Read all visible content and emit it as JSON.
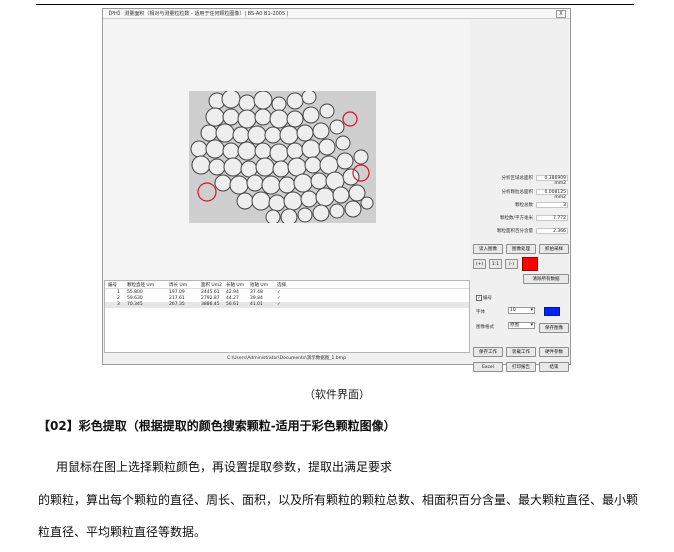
{
  "window": {
    "title": "【PH】 测量面积（相对与测量粒粒数 - 适用于任何颗粒图像）| BS-A0 B1-2005 |",
    "close": "X"
  },
  "results": [
    {
      "label": "分析区域总面积",
      "value": "0.386909 mm2"
    },
    {
      "label": "分析颗粒总面积",
      "value": "0.008125 mm2"
    },
    {
      "label": "颗粒总数",
      "value": "3"
    },
    {
      "label": "颗粒数/平方毫米",
      "value": "7.772"
    },
    {
      "label": "颗粒面积百分含量",
      "value": "2.366"
    }
  ],
  "buttons": {
    "open_image": "读入图像",
    "image_process": "图像处理",
    "pick_color": "抓拍采样",
    "zoom_in": "(+)",
    "zoom_fit": "1:1",
    "zoom_out": "(-)",
    "clear_all": "清除所有数据",
    "save_image": "保存图像",
    "save_work": "保存工作",
    "load_work": "装载工作",
    "params": "硬件参数",
    "excel": "Excel",
    "print": "打印报告",
    "exit": "结束"
  },
  "options": {
    "number_label": "编号",
    "font_label": "字体",
    "font_value": "10",
    "style_label": "图像格式",
    "style_value": "原图"
  },
  "table": {
    "headers": [
      "编号",
      "颗粒直径 Um",
      "周长 Um",
      "面积 Um2",
      "长轴 Um",
      "短轴 Um",
      "选择"
    ],
    "rows": [
      [
        "1",
        "55.800",
        "197.09",
        "2445.61",
        "42.94",
        "37.48",
        "✓"
      ],
      [
        "2",
        "59.630",
        "217.61",
        "2792.87",
        "44.27",
        "39.84",
        "✓"
      ],
      [
        "3",
        "70.345",
        "267.35",
        "3886.45",
        "56.61",
        "41.01",
        "✓"
      ]
    ]
  },
  "path": "C:\\Users\\Administrator\\Documents\\演示数据图_1.bmp",
  "caption": "（软件界面）",
  "heading": "【02】彩色提取（根据提取的颜色搜索颗粒-适用于彩色颗粒图像）",
  "paragraph": [
    "用鼠标在图上选择颗粒颜色，再设置提取参数，提取出满足要求",
    "的颗粒，算出每个颗粒的直径、周长、面积，以及所有颗粒的颗粒总数、相面积百分含量、最大颗粒直径、最小颗",
    "粒直径、平均颗粒直径等数据。"
  ]
}
